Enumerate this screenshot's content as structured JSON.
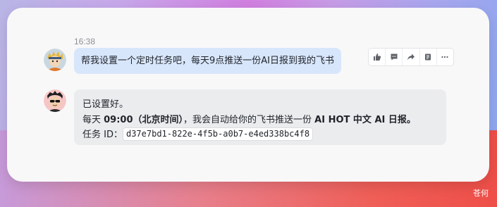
{
  "conversation": {
    "timestamp": "16:38",
    "user_message": "帮我设置一个定时任务吧，每天9点推送一份AI日报到我的飞书",
    "message_actions": [
      "thumbs-up-icon",
      "comment-icon",
      "forward-icon",
      "pin-icon",
      "more-icon"
    ],
    "bot_reply": {
      "line1": "已设置好。",
      "line2_prefix": "每天 ",
      "line2_time": "09:00（北京时间）",
      "line2_middle": "，我会自动给你的飞书推送一份 ",
      "line2_report": "AI HOT 中文 AI 日报。",
      "line3_label": "任务 ID：",
      "task_id": "d37e7bd1-822e-4f5b-a0b7-e4ed338bc4f8"
    }
  },
  "watermark": "苍何",
  "colors": {
    "user_bubble": "#d8e6fb",
    "bot_bubble": "#ebecee",
    "card": "#f8f8f9"
  }
}
